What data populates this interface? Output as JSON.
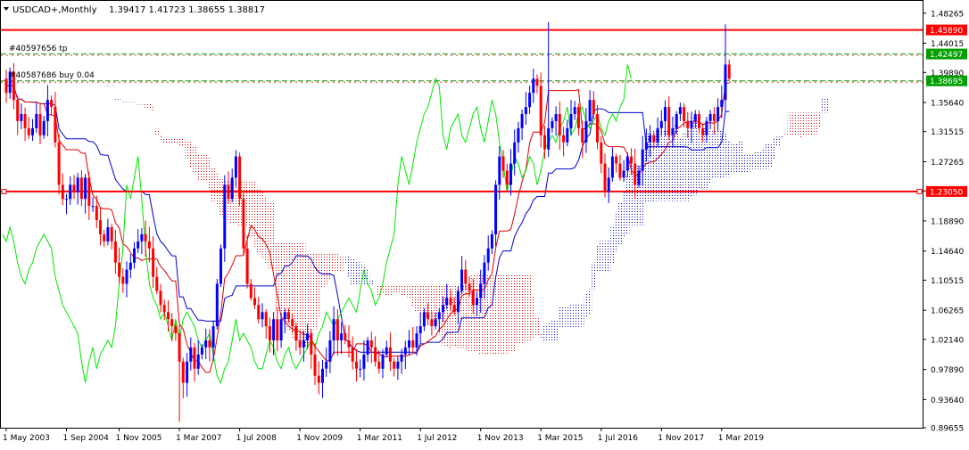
{
  "window": {
    "header_icon": "triangle-down-icon",
    "symbol_label": "USDCAD+,Monthly",
    "ohlc_text": "1.39417 1.41723 1.38655 1.38817",
    "order_label_1": "#40597656 tp",
    "order_label_2": "#40587686 buy 0.04"
  },
  "colors": {
    "background": "#ffffff",
    "frame": "#000000",
    "bull_candle": "#0000ff",
    "bear_candle": "#ff0000",
    "kijun": "#0000cd",
    "tenkan": "#dc0000",
    "chikou": "#00e600",
    "kumo_bull": "#0000cd",
    "kumo_bear": "#dc0000",
    "hline": "#ff0000",
    "tp_line": "#00a000",
    "label_green": "#00a000",
    "label_red": "#ff0000"
  },
  "chart_data": {
    "type": "candlestick",
    "symbol": "USDCAD+",
    "timeframe": "Monthly",
    "ohlc_current": {
      "open": 1.39417,
      "high": 1.41723,
      "low": 1.38655,
      "close": 1.38817
    },
    "ylim": [
      0.89655,
      1.5
    ],
    "y_ticks": [
      "1.48265",
      "1.44015",
      "1.39890",
      "1.35640",
      "1.31515",
      "1.27265",
      "1.23140",
      "1.18890",
      "1.14640",
      "1.10515",
      "1.06265",
      "1.02140",
      "0.97890",
      "0.93640",
      "0.89655"
    ],
    "x_ticks": [
      {
        "label": "1 May 2003",
        "index": 0
      },
      {
        "label": "1 Sep 2004",
        "index": 16
      },
      {
        "label": "1 Nov 2005",
        "index": 30
      },
      {
        "label": "1 Mar 2007",
        "index": 46
      },
      {
        "label": "1 Jul 2008",
        "index": 62
      },
      {
        "label": "1 Nov 2009",
        "index": 78
      },
      {
        "label": "1 Mar 2011",
        "index": 94
      },
      {
        "label": "1 Jul 2012",
        "index": 110
      },
      {
        "label": "1 Nov 2013",
        "index": 126
      },
      {
        "label": "1 Mar 2015",
        "index": 142
      },
      {
        "label": "1 Jul 2016",
        "index": 158
      },
      {
        "label": "1 Nov 2017",
        "index": 174
      },
      {
        "label": "1 Mar 2019",
        "index": 190
      }
    ],
    "closes": [
      1.37,
      1.4,
      1.36,
      1.33,
      1.34,
      1.32,
      1.31,
      1.32,
      1.34,
      1.31,
      1.33,
      1.36,
      1.35,
      1.3,
      1.24,
      1.22,
      1.22,
      1.24,
      1.23,
      1.25,
      1.22,
      1.25,
      1.21,
      1.21,
      1.19,
      1.17,
      1.16,
      1.18,
      1.16,
      1.13,
      1.11,
      1.1,
      1.12,
      1.13,
      1.15,
      1.16,
      1.17,
      1.16,
      1.15,
      1.11,
      1.09,
      1.07,
      1.06,
      1.05,
      1.04,
      1.03,
      0.99,
      0.96,
      0.99,
      1.01,
      0.98,
      1.0,
      1.01,
      1.02,
      1.01,
      1.04,
      1.1,
      1.15,
      1.24,
      1.22,
      1.25,
      1.28,
      1.22,
      1.15,
      1.1,
      1.08,
      1.07,
      1.05,
      1.06,
      1.04,
      1.02,
      1.05,
      1.02,
      1.05,
      1.06,
      1.05,
      1.04,
      1.02,
      1.01,
      1.02,
      1.03,
      1.0,
      0.97,
      0.96,
      0.98,
      0.99,
      1.02,
      1.05,
      1.02,
      1.03,
      1.02,
      1.01,
      0.99,
      0.98,
      0.98,
      1.0,
      1.02,
      1.01,
      0.99,
      0.98,
      1.0,
      1.01,
      0.99,
      0.98,
      0.99,
      1.0,
      1.01,
      1.02,
      1.01,
      1.03,
      1.04,
      1.06,
      1.05,
      1.04,
      1.05,
      1.06,
      1.07,
      1.08,
      1.07,
      1.06,
      1.09,
      1.12,
      1.1,
      1.09,
      1.07,
      1.08,
      1.1,
      1.13,
      1.15,
      1.17,
      1.24,
      1.28,
      1.26,
      1.24,
      1.27,
      1.3,
      1.32,
      1.34,
      1.35,
      1.37,
      1.39,
      1.38,
      1.31,
      1.29,
      1.32,
      1.33,
      1.34,
      1.31,
      1.3,
      1.32,
      1.34,
      1.35,
      1.32,
      1.3,
      1.33,
      1.36,
      1.34,
      1.3,
      1.27,
      1.23,
      1.25,
      1.28,
      1.27,
      1.25,
      1.26,
      1.28,
      1.27,
      1.24,
      1.26,
      1.29,
      1.3,
      1.31,
      1.3,
      1.32,
      1.33,
      1.35,
      1.31,
      1.32,
      1.34,
      1.35,
      1.33,
      1.32,
      1.33,
      1.34,
      1.32,
      1.31,
      1.33,
      1.34,
      1.33,
      1.35,
      1.36,
      1.41,
      1.39
    ],
    "h_lines": [
      {
        "price": 1.4589,
        "label": "1.45890",
        "kind": "resistance"
      },
      {
        "price": 1.42497,
        "label": "1.42497",
        "kind": "take-profit"
      },
      {
        "price": 1.38695,
        "label": "1.38695",
        "kind": "entry"
      },
      {
        "price": 1.2305,
        "label": "1.23050",
        "kind": "support"
      }
    ],
    "indicators": [
      "Ichimoku Kinko Hyo"
    ],
    "grid": false
  }
}
